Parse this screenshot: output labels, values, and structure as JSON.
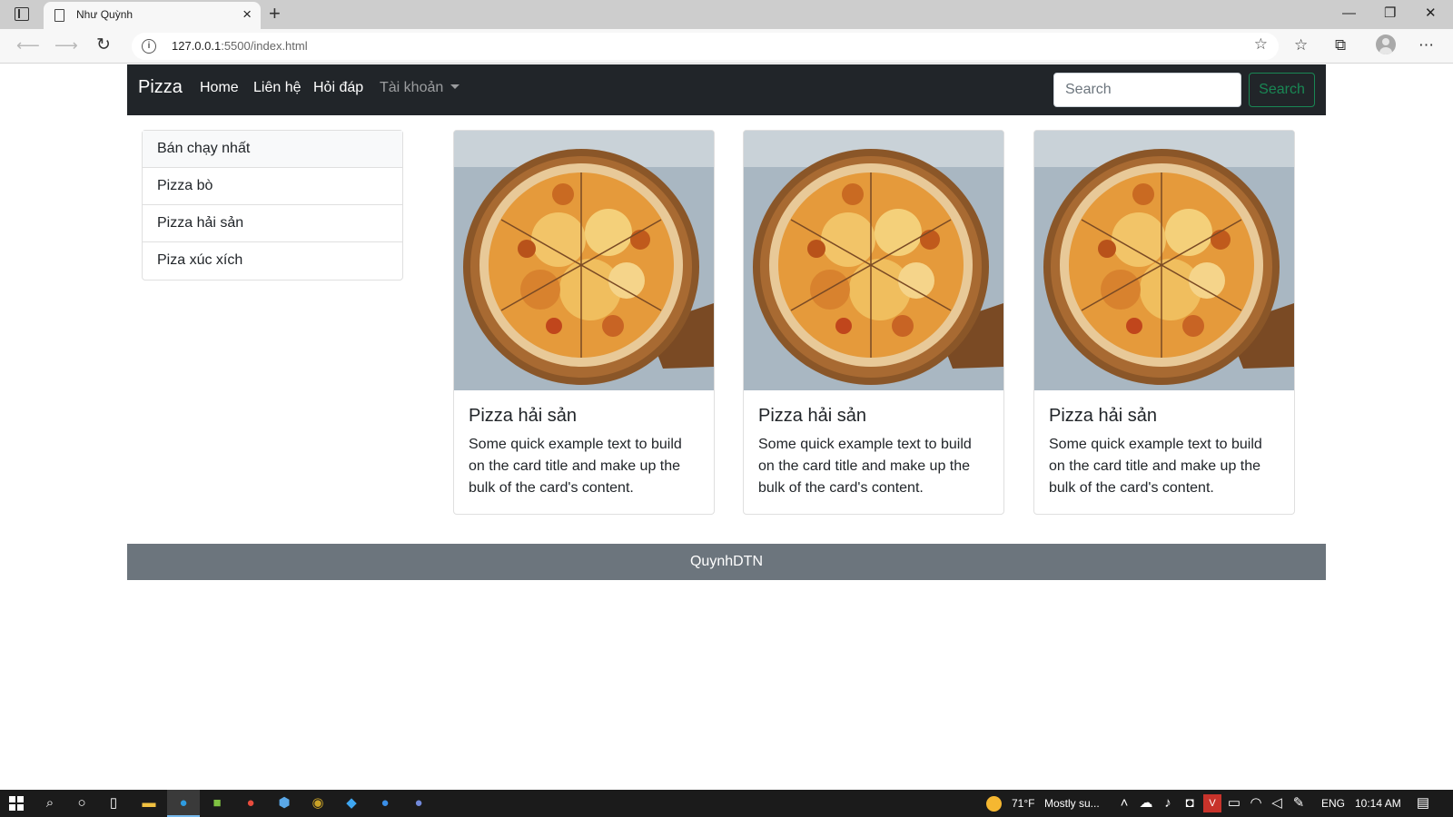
{
  "browser": {
    "tab_title": "Như Quỳnh",
    "new_tab_label": "+",
    "window_controls": {
      "minimize": "—",
      "restore": "❐",
      "close": "✕"
    },
    "url_host": "127.0.0.1",
    "url_rest": ":5500/index.html"
  },
  "navbar": {
    "brand": "Pizza",
    "links": [
      "Home",
      "Liên hệ",
      "Hỏi đáp"
    ],
    "dropdown_label": "Tài khoản",
    "search_placeholder": "Search",
    "search_value": "",
    "search_button": "Search"
  },
  "categories": [
    "Bán chạy nhất",
    "Pizza bò",
    "Pizza hải sản",
    "Piza xúc xích"
  ],
  "cards": [
    {
      "title": "Pizza hải sản",
      "text": "Some quick example text to build on the card title and make up the bulk of the card's content."
    },
    {
      "title": "Pizza hải sản",
      "text": "Some quick example text to build on the card title and make up the bulk of the card's content."
    },
    {
      "title": "Pizza hải sản",
      "text": "Some quick example text to build on the card title and make up the bulk of the card's content."
    }
  ],
  "footer": {
    "text": "QuynhDTN"
  },
  "taskbar": {
    "weather_temp": "71°F",
    "weather_desc": "Mostly su...",
    "language": "ENG",
    "time": "10:14 AM"
  },
  "colors": {
    "navbar_bg": "#212529",
    "footer_bg": "#6c757d",
    "search_button": "#198754"
  }
}
